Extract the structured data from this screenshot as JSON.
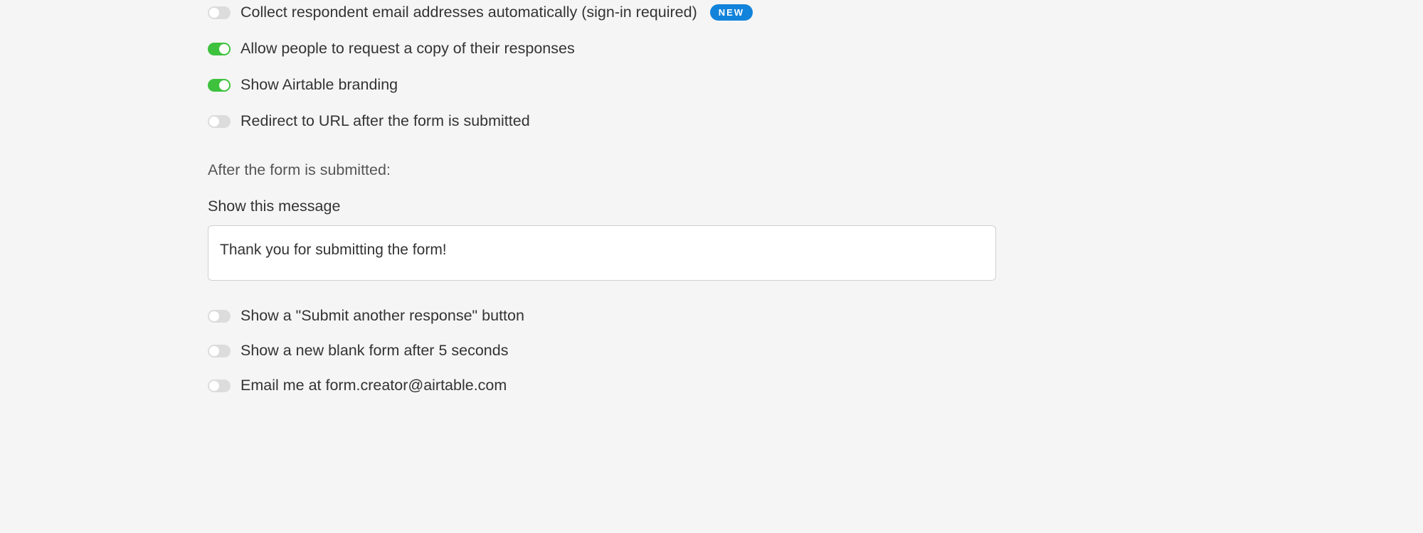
{
  "toggles_top": [
    {
      "key": "collect-email",
      "label": "Collect respondent email addresses automatically (sign-in required)",
      "on": false,
      "badge": "NEW"
    },
    {
      "key": "allow-copy",
      "label": "Allow people to request a copy of their responses",
      "on": true
    },
    {
      "key": "show-branding",
      "label": "Show Airtable branding",
      "on": true
    },
    {
      "key": "redirect-url",
      "label": "Redirect to URL after the form is submitted",
      "on": false
    }
  ],
  "after_submit": {
    "header": "After the form is submitted:",
    "message_label": "Show this message",
    "message_value": "Thank you for submitting the form!"
  },
  "toggles_bottom": [
    {
      "key": "submit-another",
      "label": "Show a \"Submit another response\" button",
      "on": false
    },
    {
      "key": "blank-form",
      "label": "Show a new blank form after 5 seconds",
      "on": false
    },
    {
      "key": "email-me",
      "label": "Email me at form.creator@airtable.com",
      "on": false
    }
  ]
}
